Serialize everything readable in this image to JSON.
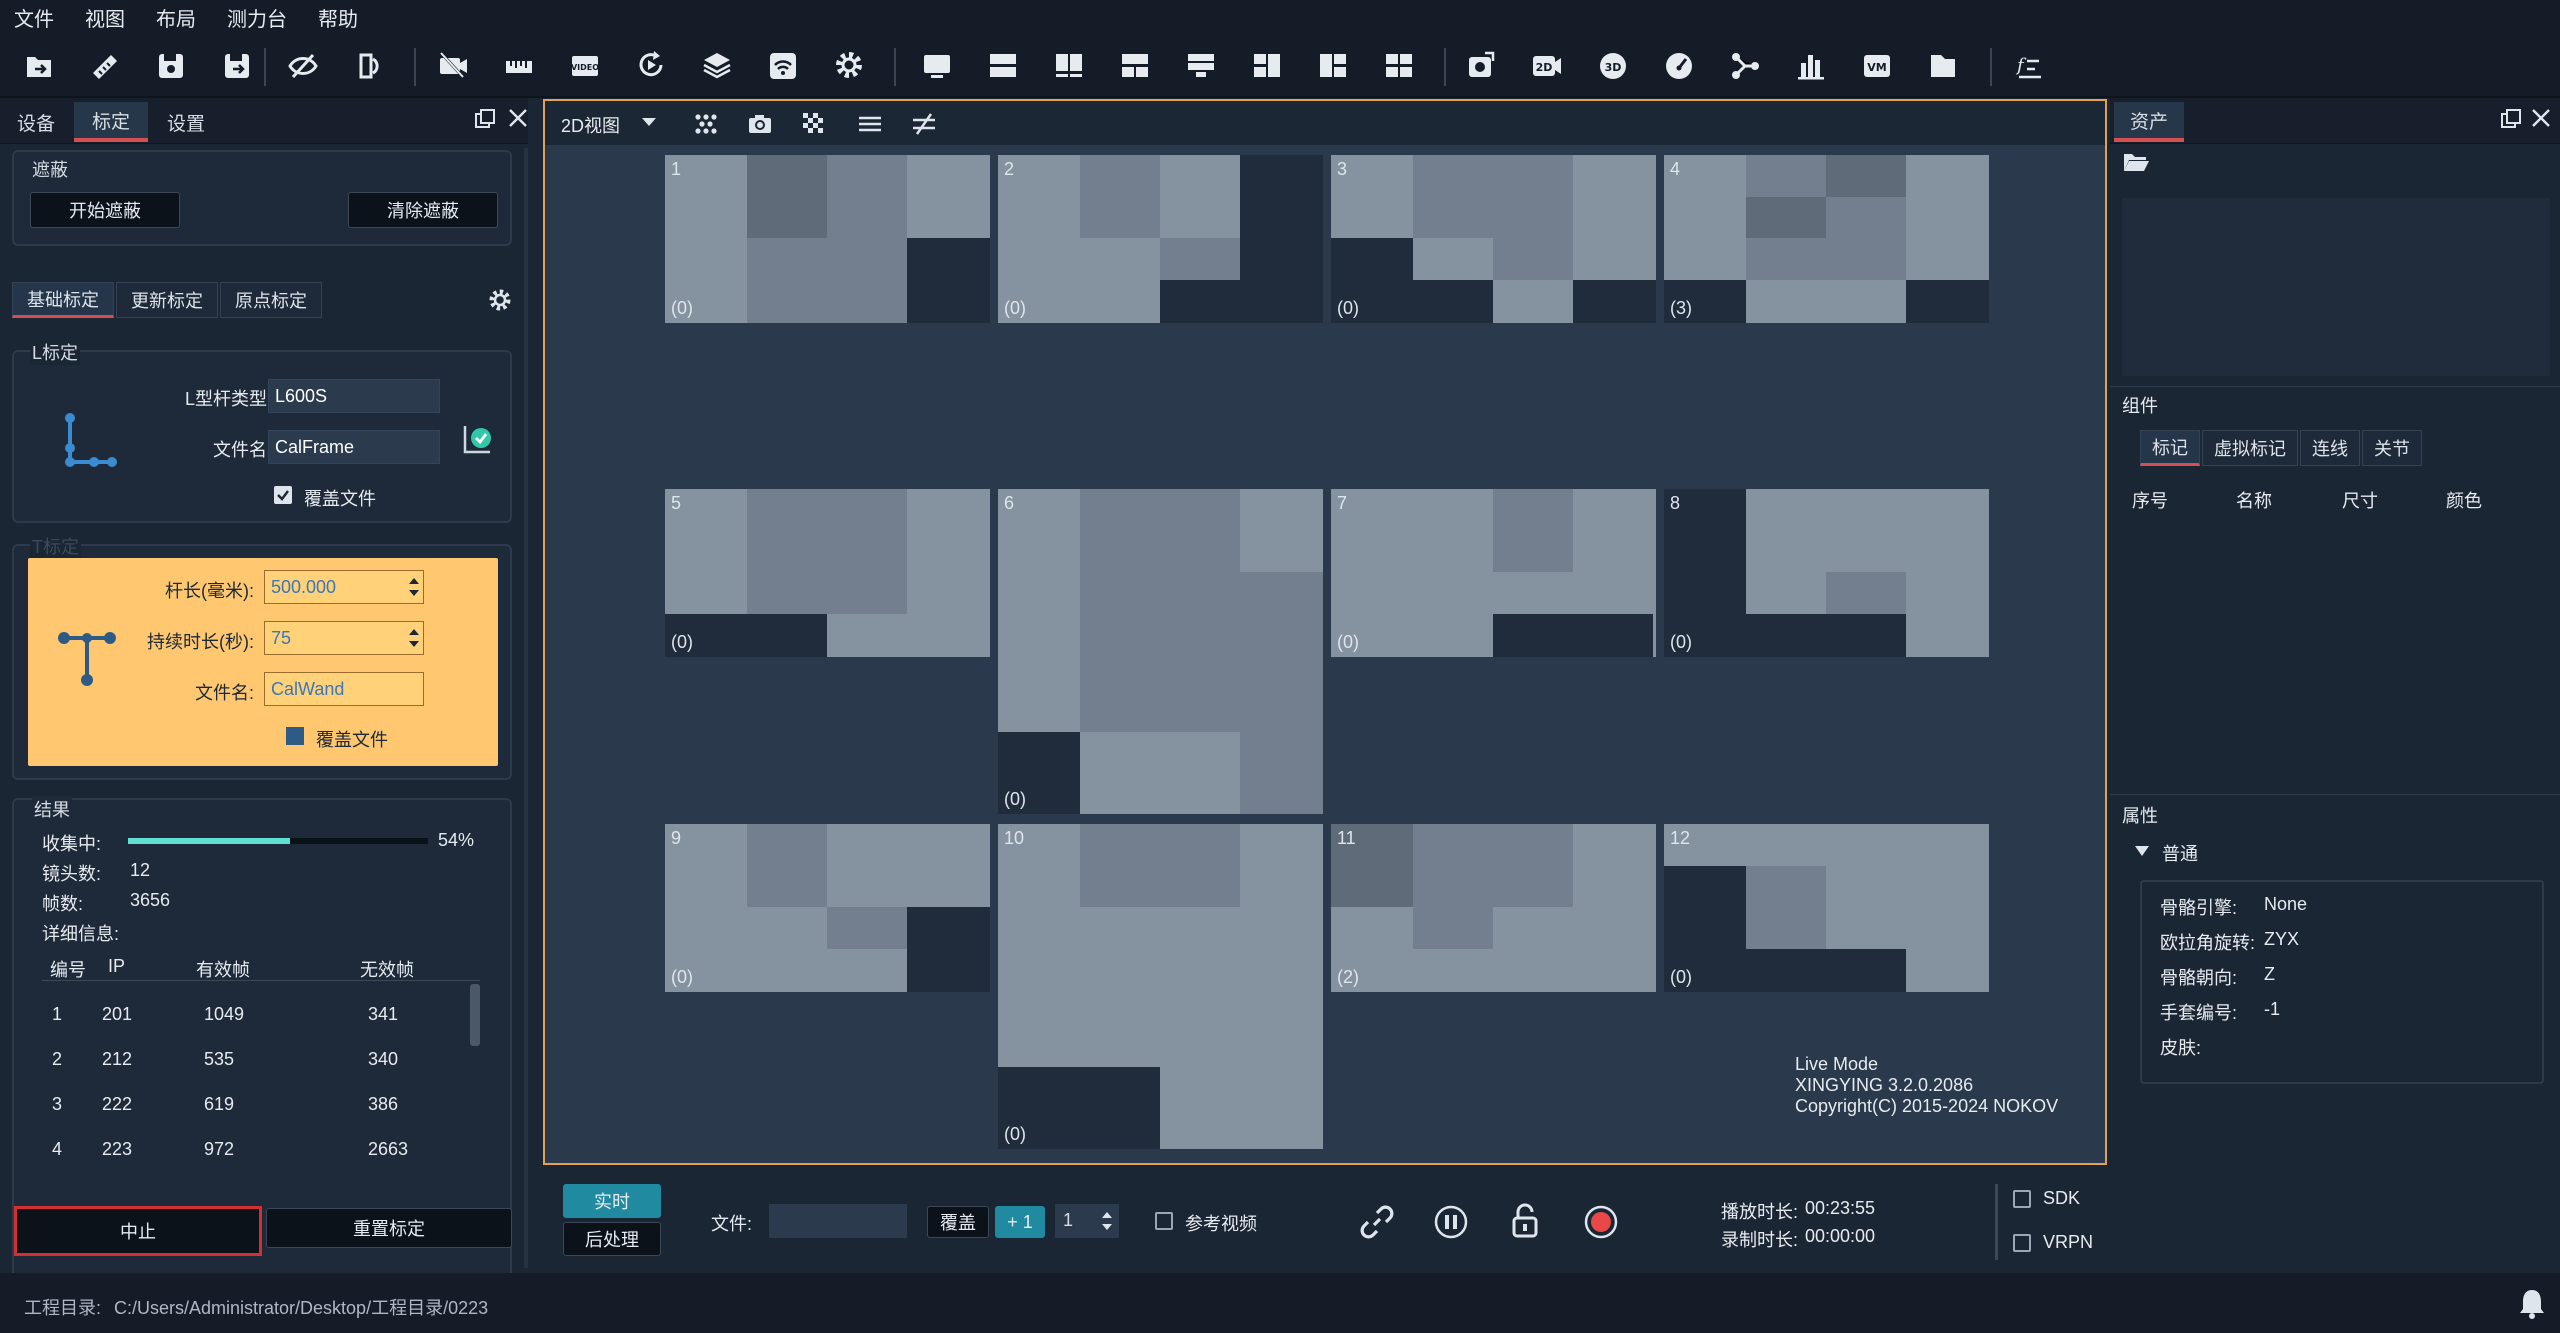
{
  "menu": [
    "文件",
    "视图",
    "布局",
    "测力台",
    "帮助"
  ],
  "toolbar_icons": [
    "open-project-icon",
    "ruler-icon",
    "save-icon",
    "save-as-icon",
    "hide-icon",
    "swap-icon",
    "camera-off-icon",
    "measure-icon",
    "video-icon",
    "refresh-icon",
    "layers-icon",
    "wifi-icon",
    "settings-icon",
    "layout-1-icon",
    "layout-2-icon",
    "layout-3-icon",
    "layout-4-icon",
    "layout-5-icon",
    "layout-6-icon",
    "layout-7-icon",
    "layout-8-icon",
    "camera-rotate-icon",
    "2d-icon",
    "3d-icon",
    "speedometer-icon",
    "skeleton-icon",
    "bar-chart-icon",
    "vm-icon",
    "document-icon",
    "function-icon"
  ],
  "left_panel": {
    "tabs": [
      "设备",
      "标定",
      "设置"
    ],
    "mask": {
      "title": "遮蔽",
      "start_btn": "开始遮蔽",
      "clear_btn": "清除遮蔽"
    },
    "calib_tabs": [
      "基础标定",
      "更新标定",
      "原点标定"
    ],
    "l_calib": {
      "title": "L标定",
      "type_label": "L型杆类型:",
      "type_value": "L600S",
      "file_label": "文件名:",
      "file_value": "CalFrame",
      "overwrite_label": "覆盖文件"
    },
    "t_calib": {
      "title": "T标定",
      "length_label": "杆长(毫米):",
      "length_value": "500.000",
      "duration_label": "持续时长(秒):",
      "duration_value": "75",
      "file_label": "文件名:",
      "file_value": "CalWand",
      "overwrite_label": "覆盖文件"
    },
    "results": {
      "title": "结果",
      "collecting_label": "收集中:",
      "progress": 0.54,
      "progress_text": "54%",
      "lens_label": "镜头数:",
      "lens_value": "12",
      "frames_label": "帧数:",
      "frames_value": "3656",
      "detail_label": "详细信息:",
      "columns": [
        "编号",
        "IP",
        "有效帧",
        "无效帧"
      ],
      "rows": [
        [
          "1",
          "201",
          "1049",
          "341"
        ],
        [
          "2",
          "212",
          "535",
          "340"
        ],
        [
          "3",
          "222",
          "619",
          "386"
        ],
        [
          "4",
          "223",
          "972",
          "2663"
        ]
      ]
    },
    "stop_btn": "中止",
    "recalib_btn": "重置标定"
  },
  "viewport": {
    "mode_label": "2D视图",
    "cameras": [
      {
        "num": "1",
        "count": "(0)"
      },
      {
        "num": "2",
        "count": "(0)"
      },
      {
        "num": "3",
        "count": "(0)"
      },
      {
        "num": "4",
        "count": "(3)"
      },
      {
        "num": "5",
        "count": "(0)"
      },
      {
        "num": "6",
        "count": "(0)"
      },
      {
        "num": "7",
        "count": "(0)"
      },
      {
        "num": "8",
        "count": "(0)"
      },
      {
        "num": "9",
        "count": "(0)"
      },
      {
        "num": "10",
        "count": "(0)"
      },
      {
        "num": "11",
        "count": "(2)"
      },
      {
        "num": "12",
        "count": "(0)"
      }
    ],
    "info": [
      "Live Mode",
      "XINGYING 3.2.0.2086",
      "Copyright(C) 2015-2024 NOKOV"
    ]
  },
  "playback": {
    "realtime_btn": "实时",
    "postprocess_btn": "后处理",
    "file_label": "文件:",
    "file_value": "",
    "overwrite_btn": "覆盖",
    "plus_btn": "+ 1",
    "step_value": "1",
    "ref_video_label": "参考视频",
    "play_duration_label": "播放时长:",
    "play_duration": "00:23:55",
    "record_duration_label": "录制时长:",
    "record_duration": "00:00:00",
    "sdk_label": "SDK",
    "vrpn_label": "VRPN"
  },
  "right_panel": {
    "tab": "资产",
    "components_title": "组件",
    "component_tabs": [
      "标记",
      "虚拟标记",
      "连线",
      "关节"
    ],
    "columns": [
      "序号",
      "名称",
      "尺寸",
      "颜色"
    ],
    "props_title": "属性",
    "props_group": "普通",
    "props": [
      [
        "骨骼引擎:",
        "None"
      ],
      [
        "欧拉角旋转:",
        "ZYX"
      ],
      [
        "骨骼朝向:",
        "Z"
      ],
      [
        "手套编号:",
        "-1"
      ],
      [
        "皮肤:",
        ""
      ]
    ]
  },
  "status": {
    "label": "工程目录:",
    "path": "C:/Users/Administrator/Desktop/工程目录/0223"
  },
  "colors": {
    "accent_red": "#d45050",
    "teal": "#1f8aa0",
    "progress": "#5fe0d0",
    "t_calib_bg": "#ffc870"
  }
}
